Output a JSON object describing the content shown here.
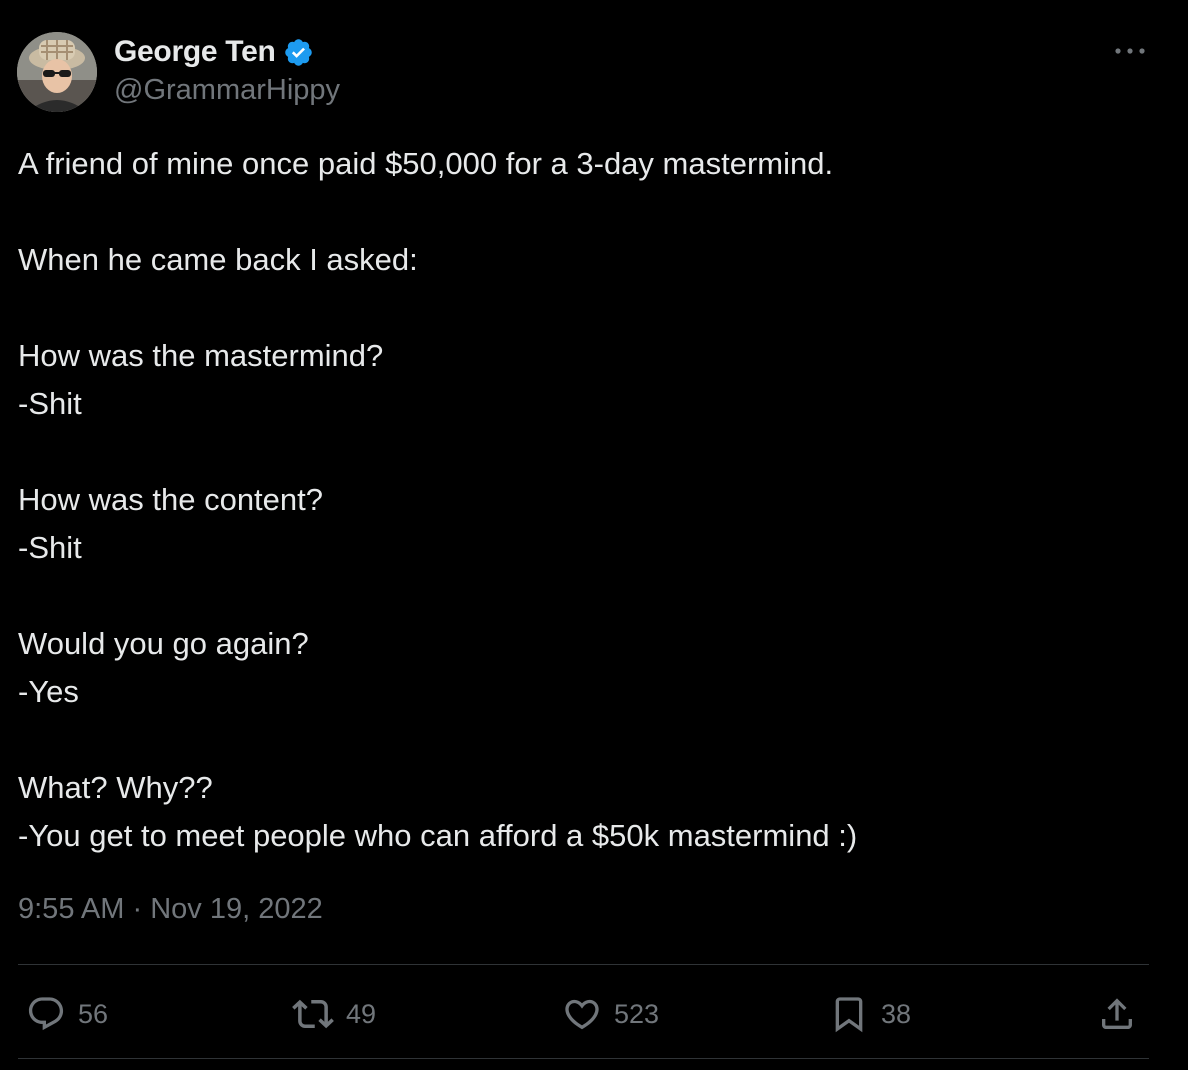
{
  "author": {
    "display_name": "George Ten",
    "handle": "@GrammarHippy",
    "verified": true
  },
  "icons": {
    "verified": "verified-badge-icon",
    "more": "more-options-icon",
    "reply": "reply-icon",
    "retweet": "retweet-icon",
    "like": "like-icon",
    "bookmark": "bookmark-icon",
    "share": "share-icon"
  },
  "colors": {
    "background": "#000000",
    "text": "#e7e9ea",
    "secondary": "#71767b",
    "verified": "#1d9bf0",
    "divider": "#2f3336"
  },
  "tweet": {
    "paragraphs": [
      [
        "A friend of mine once paid $50,000 for a 3-day mastermind."
      ],
      [
        "When he came back I asked:"
      ],
      [
        "How was the mastermind?",
        "-Shit"
      ],
      [
        "How was the content?",
        "-Shit"
      ],
      [
        "Would you go again?",
        "-Yes"
      ],
      [
        "What? Why??",
        "-You get to meet people who can afford a $50k mastermind :)"
      ]
    ],
    "time": "9:55 AM",
    "separator": "·",
    "date": "Nov 19, 2022"
  },
  "actions": {
    "replies": "56",
    "retweets": "49",
    "likes": "523",
    "bookmarks": "38"
  }
}
